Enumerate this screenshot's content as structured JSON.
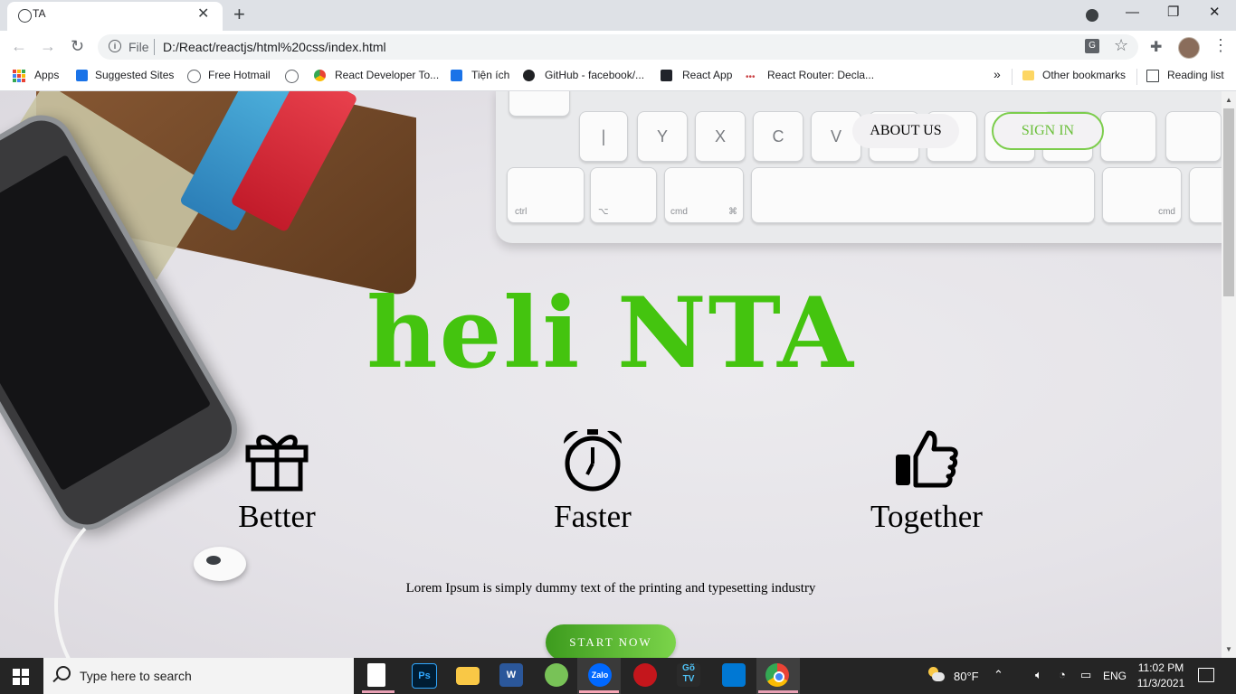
{
  "browser": {
    "tab_title": "TA",
    "tab_close": "✕",
    "new_tab": "+",
    "window_controls": {
      "minimize": "—",
      "restore": "❐",
      "close": "✕"
    },
    "nav": {
      "back": "←",
      "forward": "→",
      "reload": "↻"
    },
    "omnibox": {
      "scheme_label": "File",
      "url": "D:/React/reactjs/html%20css/index.html"
    },
    "bookmarks": [
      {
        "label": "Apps",
        "icon": "apps-grid-icon",
        "color": "#ea4335"
      },
      {
        "label": "Suggested Sites",
        "icon": "bing-icon",
        "color": "#1a73e8"
      },
      {
        "label": "Free Hotmail",
        "icon": "globe-icon",
        "color": "#5f6368"
      },
      {
        "label": "",
        "icon": "globe-icon",
        "color": "#5f6368"
      },
      {
        "label": "React Developer To...",
        "icon": "webstore-icon",
        "color": "#fbbc04"
      },
      {
        "label": "Tiện ích",
        "icon": "puzzle-icon",
        "color": "#1a73e8"
      },
      {
        "label": "GitHub - facebook/...",
        "icon": "github-icon",
        "color": "#202124"
      },
      {
        "label": "React App",
        "icon": "react-icon",
        "color": "#20232a"
      },
      {
        "label": "React Router: Decla...",
        "icon": "react-router-icon",
        "color": "#ca4245"
      }
    ],
    "bookmarks_overflow": "»",
    "other_bookmarks": "Other bookmarks",
    "reading_list": "Reading list"
  },
  "page": {
    "nav": {
      "about": "ABOUT US",
      "signin": "SIGN IN"
    },
    "hero_title": "heli NTA",
    "features": [
      {
        "label": "Better",
        "icon": "gift-icon"
      },
      {
        "label": "Faster",
        "icon": "alarm-clock-icon"
      },
      {
        "label": "Together",
        "icon": "thumbs-up-icon"
      }
    ],
    "tagline": "Lorem Ipsum is simply dummy text of the printing and typesetting industry",
    "cta": "START NOW",
    "accent_color": "#44c40f",
    "keyboard_keys": {
      "row1": [
        "|\\",
        "Y",
        "X",
        "C",
        "V"
      ],
      "row2": [
        "ctrl",
        "⌥",
        "cmd",
        "⌘",
        "cmd"
      ]
    }
  },
  "taskbar": {
    "search_placeholder": "Type here to search",
    "apps": [
      {
        "name": "notepad",
        "label": ""
      },
      {
        "name": "photoshop",
        "label": "Ps"
      },
      {
        "name": "file-explorer",
        "label": ""
      },
      {
        "name": "word",
        "label": "W"
      },
      {
        "name": "android-studio",
        "label": ""
      },
      {
        "name": "zalo",
        "label": "Zalo"
      },
      {
        "name": "app-red",
        "label": ""
      },
      {
        "name": "gotv",
        "label": "Gõ TV"
      },
      {
        "name": "vscode",
        "label": ""
      },
      {
        "name": "chrome",
        "label": ""
      }
    ],
    "temperature": "80°F",
    "language": "ENG",
    "time": "11:02 PM",
    "date": "11/3/2021"
  }
}
